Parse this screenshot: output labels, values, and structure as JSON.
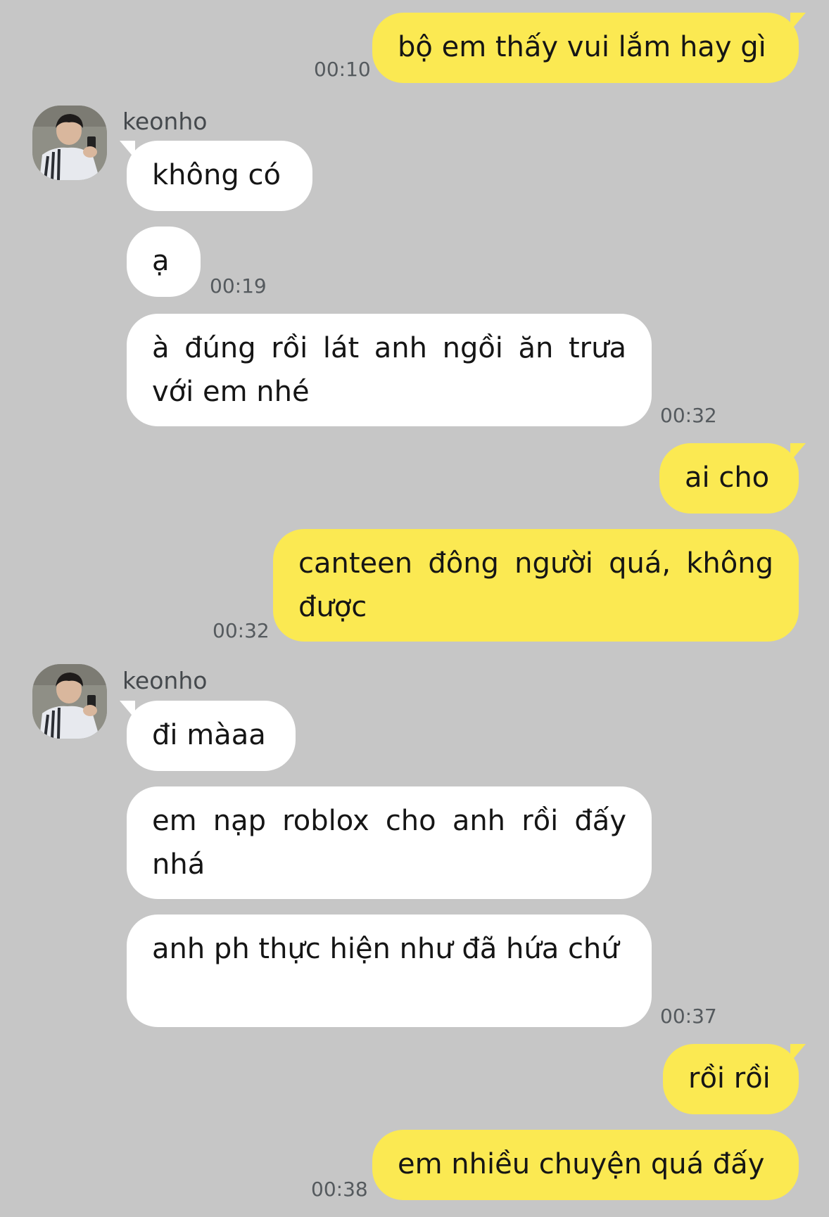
{
  "chat": {
    "sender_name": "keonho",
    "messages": [
      {
        "side": "out",
        "text": "bộ em thấy vui lắm hay gì",
        "time": "00:10"
      },
      {
        "side": "in",
        "text": "không có"
      },
      {
        "side": "in",
        "text": "ạ",
        "time": "00:19"
      },
      {
        "side": "in",
        "text": "à đúng rồi lát anh ngồi ăn trưa với em nhé",
        "time": "00:32"
      },
      {
        "side": "out",
        "text": "ai cho"
      },
      {
        "side": "out",
        "text": "canteen đông người quá, không được",
        "time": "00:32"
      },
      {
        "side": "in",
        "text": "đi màaa"
      },
      {
        "side": "in",
        "text": "em nạp roblox cho anh rồi đấy nhá"
      },
      {
        "side": "in",
        "text": "anh ph thực hiện như đã hứa chứ",
        "time": "00:37"
      },
      {
        "side": "out",
        "text": "rồi rồi"
      },
      {
        "side": "out",
        "text": "em nhiều chuyện quá đấy",
        "time": "00:38"
      }
    ]
  },
  "colors": {
    "background": "#c6c6c6",
    "outgoing_bubble": "#fbe952",
    "incoming_bubble": "#ffffff",
    "text": "#151515",
    "timestamp": "#555a5e"
  }
}
